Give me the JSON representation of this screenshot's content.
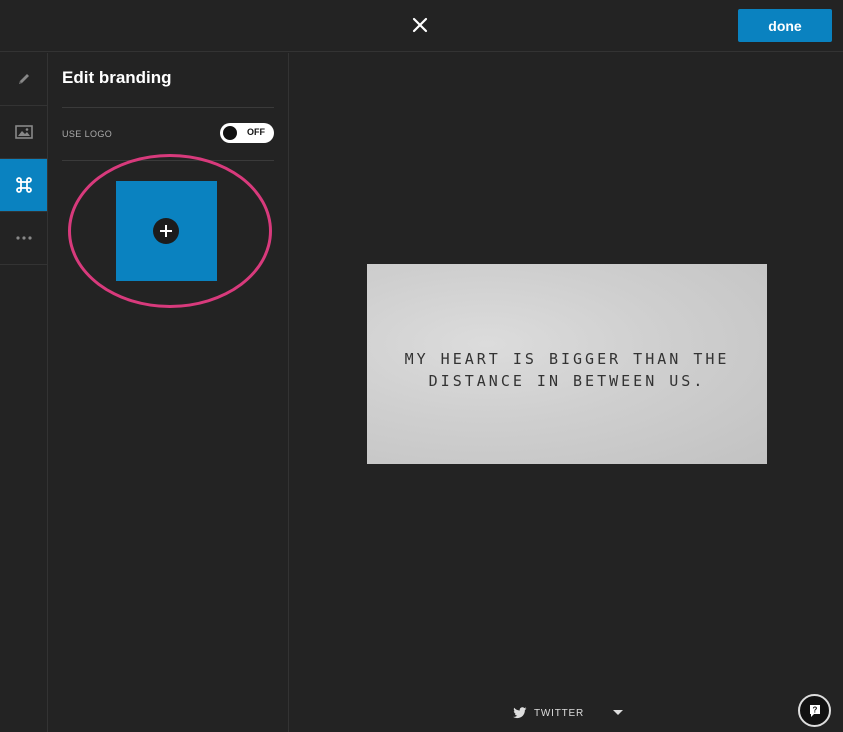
{
  "header": {
    "close_icon": "close-icon",
    "done_label": "done",
    "accent_color": "#0a82c0"
  },
  "rail": {
    "items": [
      {
        "icon": "pencil-icon",
        "active": false
      },
      {
        "icon": "image-icon",
        "active": false
      },
      {
        "icon": "command-icon",
        "active": true
      },
      {
        "icon": "more-dots-icon",
        "active": false
      }
    ]
  },
  "panel": {
    "title": "Edit branding",
    "use_logo_label": "USE LOGO",
    "toggle_state": "OFF",
    "logo_upload_icon": "plus-circle-icon",
    "highlight_color": "#d83a7c"
  },
  "preview": {
    "quote_line1": "MY HEART IS BIGGER THAN THE",
    "quote_line2": "DISTANCE IN BETWEEN US."
  },
  "share": {
    "platform_label": "TWITTER",
    "icon": "twitter-icon"
  },
  "help": {
    "icon": "help-chat-icon"
  }
}
